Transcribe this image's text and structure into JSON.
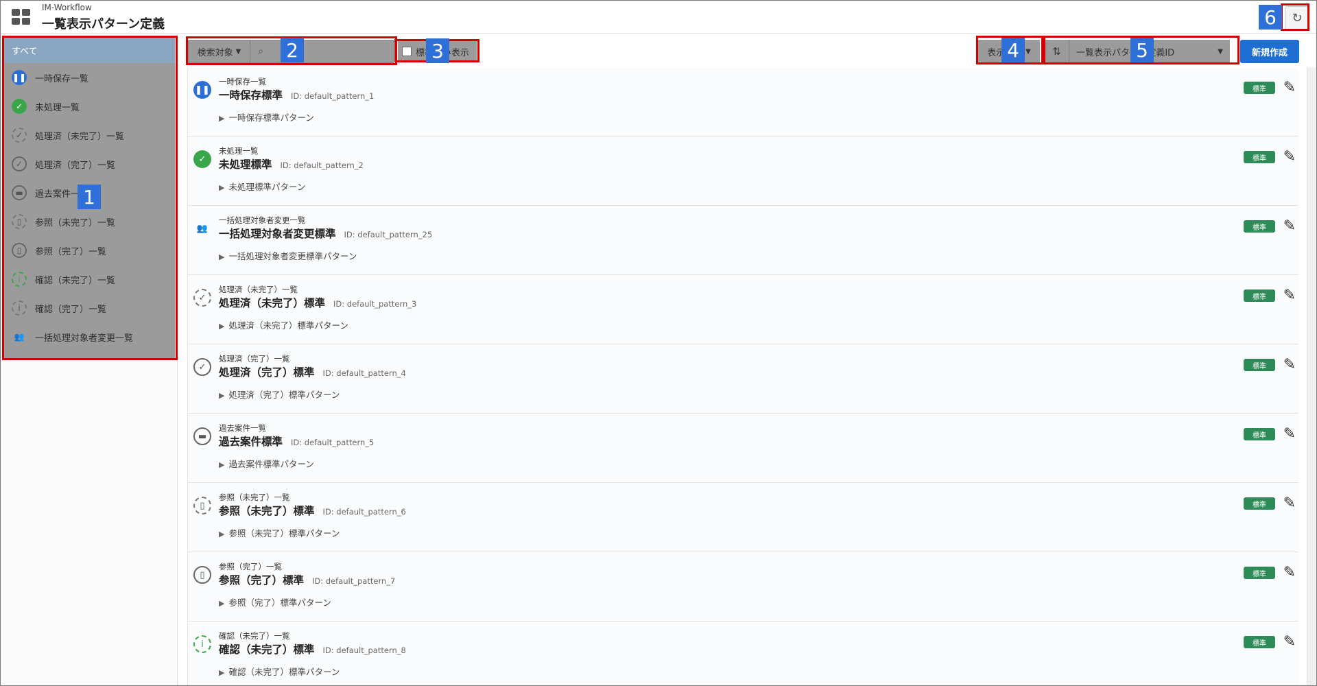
{
  "header": {
    "app_sub": "IM-Workflow",
    "title": "一覧表示パターン定義",
    "refresh_icon": "↻"
  },
  "sidebar": {
    "items": [
      {
        "label": "すべて",
        "icon": "",
        "active": true
      },
      {
        "label": "一時保存一覧",
        "icon": "pause-icon"
      },
      {
        "label": "未処理一覧",
        "icon": "check-circle-icon"
      },
      {
        "label": "処理済（未完了）一覧",
        "icon": "dashed-check-icon"
      },
      {
        "label": "処理済（完了）一覧",
        "icon": "check-icon"
      },
      {
        "label": "過去案件一覧",
        "icon": "folder-icon"
      },
      {
        "label": "参照（未完了）一覧",
        "icon": "dashed-doc-icon"
      },
      {
        "label": "参照（完了）一覧",
        "icon": "doc-icon"
      },
      {
        "label": "確認（未完了）一覧",
        "icon": "dashed-info-icon"
      },
      {
        "label": "確認（完了）一覧",
        "icon": "info-icon"
      },
      {
        "label": "一括処理対象者変更一覧",
        "icon": "users-icon"
      }
    ]
  },
  "toolbar": {
    "search_target": "検索対象",
    "search_placeholder": "",
    "standard_only": "標準のみ表示",
    "display": "表示",
    "sort_field": "一覧表示パターン定義ID",
    "new_button": "新規作成"
  },
  "annotations": [
    "1",
    "2",
    "3",
    "4",
    "5",
    "6"
  ],
  "rows": [
    {
      "category": "一時保存一覧",
      "name": "一時保存標準",
      "id": "ID: default_pattern_1",
      "desc": "一時保存標準パターン",
      "icon": "pause-icon"
    },
    {
      "category": "未処理一覧",
      "name": "未処理標準",
      "id": "ID: default_pattern_2",
      "desc": "未処理標準パターン",
      "icon": "check-circle-icon"
    },
    {
      "category": "一括処理対象者変更一覧",
      "name": "一括処理対象者変更標準",
      "id": "ID: default_pattern_25",
      "desc": "一括処理対象者変更標準パターン",
      "icon": "users-icon"
    },
    {
      "category": "処理済（未完了）一覧",
      "name": "処理済（未完了）標準",
      "id": "ID: default_pattern_3",
      "desc": "処理済（未完了）標準パターン",
      "icon": "dashed-check-icon"
    },
    {
      "category": "処理済（完了）一覧",
      "name": "処理済（完了）標準",
      "id": "ID: default_pattern_4",
      "desc": "処理済（完了）標準パターン",
      "icon": "check-icon"
    },
    {
      "category": "過去案件一覧",
      "name": "過去案件標準",
      "id": "ID: default_pattern_5",
      "desc": "過去案件標準パターン",
      "icon": "folder-icon"
    },
    {
      "category": "参照（未完了）一覧",
      "name": "参照（未完了）標準",
      "id": "ID: default_pattern_6",
      "desc": "参照（未完了）標準パターン",
      "icon": "dashed-doc-icon"
    },
    {
      "category": "参照（完了）一覧",
      "name": "参照（完了）標準",
      "id": "ID: default_pattern_7",
      "desc": "参照（完了）標準パターン",
      "icon": "doc-icon"
    },
    {
      "category": "確認（未完了）一覧",
      "name": "確認（未完了）標準",
      "id": "ID: default_pattern_8",
      "desc": "確認（未完了）標準パターン",
      "icon": "dashed-info-icon"
    }
  ],
  "row_badge": "標準"
}
